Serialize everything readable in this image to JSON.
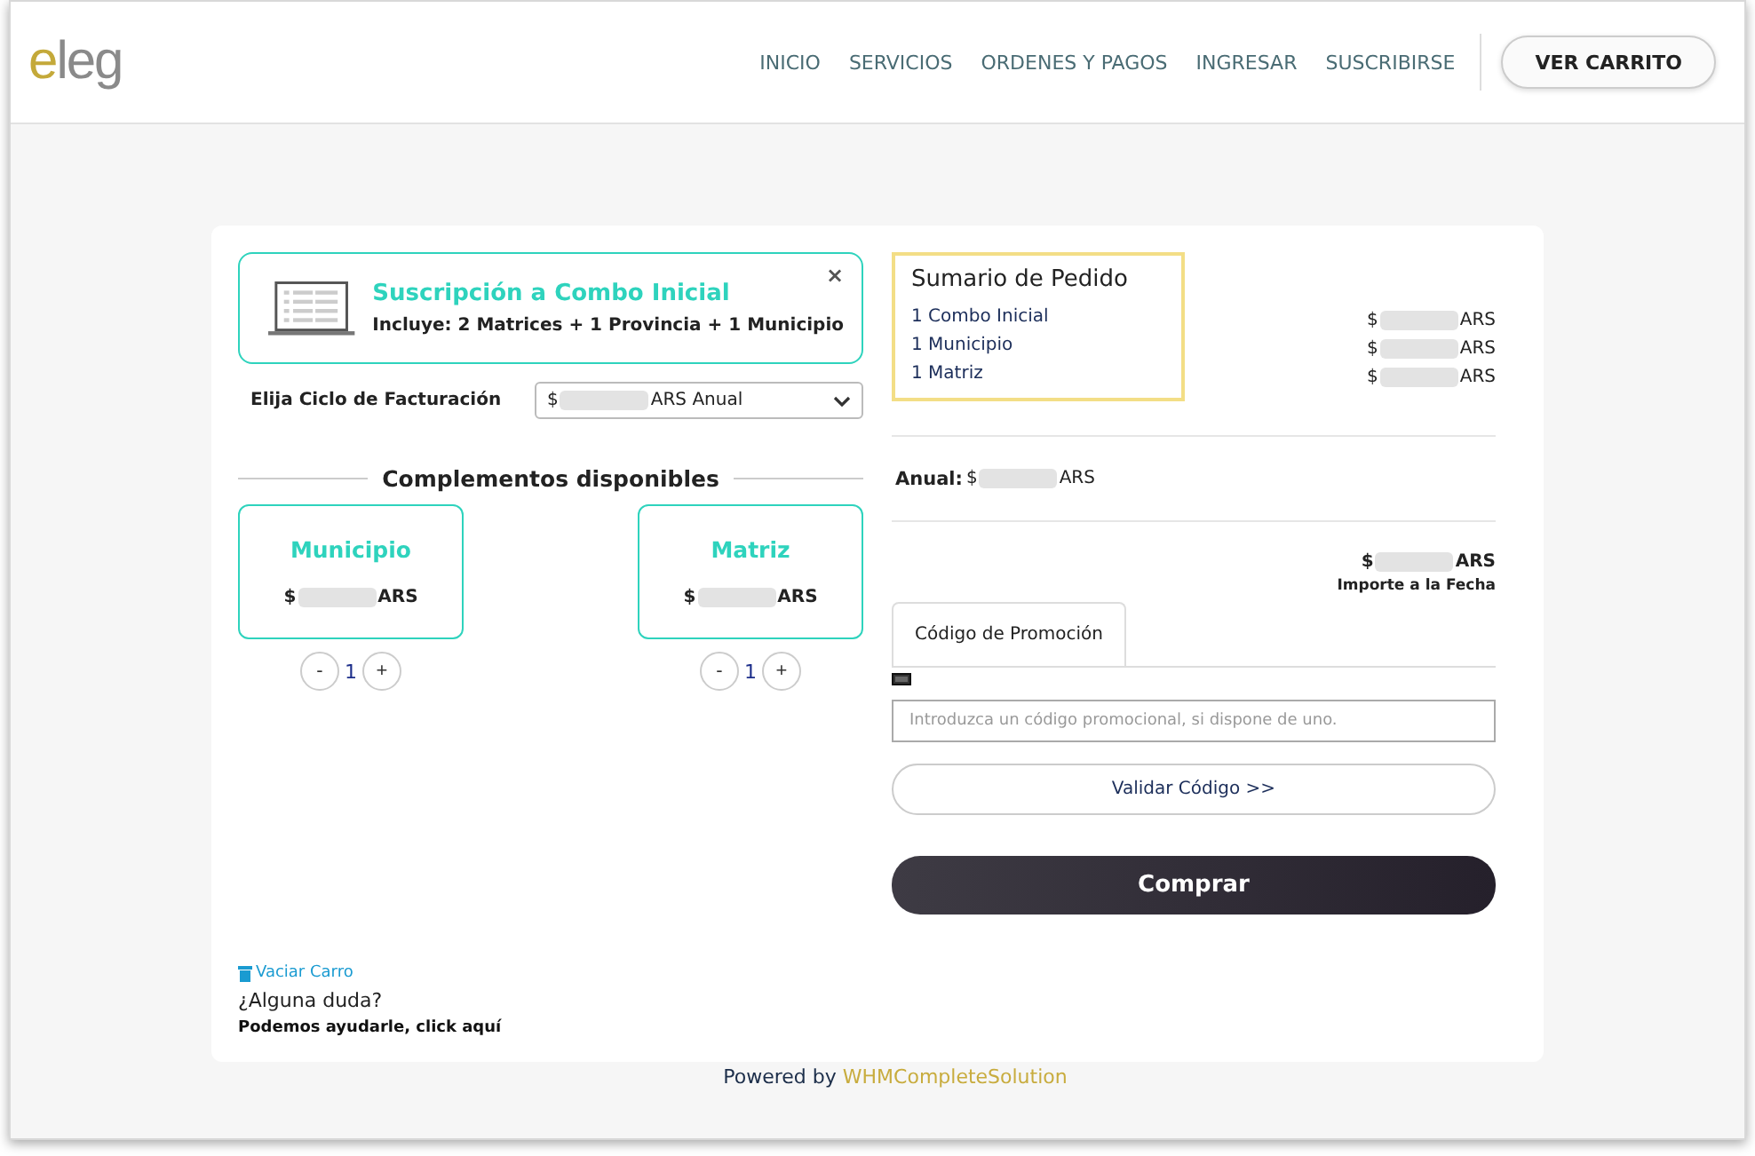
{
  "header": {
    "logo": "eleg",
    "nav": [
      "INICIO",
      "SERVICIOS",
      "ORDENES Y PAGOS",
      "INGRESAR",
      "SUSCRIBIRSE"
    ],
    "cart_button": "VER CARRITO"
  },
  "product": {
    "title": "Suscripción a Combo Inicial",
    "includes": "Incluye: 2 Matrices + 1 Provincia + 1 Municipio",
    "remove": "×"
  },
  "billing": {
    "label": "Elija Ciclo de Facturación",
    "value": {
      "prefix": "$",
      "suffix": "ARS Anual"
    }
  },
  "addons": {
    "title": "Complementos disponibles",
    "items": [
      {
        "name": "Municipio",
        "price": {
          "prefix": "$",
          "suffix": "ARS"
        },
        "minus": "-",
        "quantity": "1",
        "plus": "+"
      },
      {
        "name": "Matriz",
        "price": {
          "prefix": "$",
          "suffix": "ARS"
        },
        "minus": "-",
        "quantity": "1",
        "plus": "+"
      }
    ]
  },
  "summary": {
    "title": "Sumario de Pedido",
    "items": [
      {
        "label": "1 Combo Inicial",
        "price": {
          "prefix": "$",
          "suffix": "ARS"
        }
      },
      {
        "label": "1 Municipio",
        "price": {
          "prefix": "$",
          "suffix": "ARS"
        }
      },
      {
        "label": "1 Matriz",
        "price": {
          "prefix": "$",
          "suffix": "ARS"
        }
      }
    ],
    "recurring": {
      "label": "Anual:",
      "price": {
        "prefix": "$",
        "suffix": "ARS"
      }
    },
    "total": {
      "price": {
        "prefix": "$",
        "suffix": "ARS"
      },
      "caption": "Importe a la Fecha"
    }
  },
  "promo": {
    "tabs": [
      {
        "label": "Código de Promoción",
        "selected": true
      }
    ],
    "placeholder": "Introduzca un código promocional, si dispone de uno.",
    "validate": "Validar Código >>"
  },
  "checkout": "Comprar",
  "footer_links": {
    "empty_cart": "Vaciar Carro",
    "question": "¿Alguna duda?",
    "help": "Podemos ayudarle, click aquí"
  },
  "powered": {
    "text": "Powered by",
    "brand": "WHMCompleteSolution"
  }
}
